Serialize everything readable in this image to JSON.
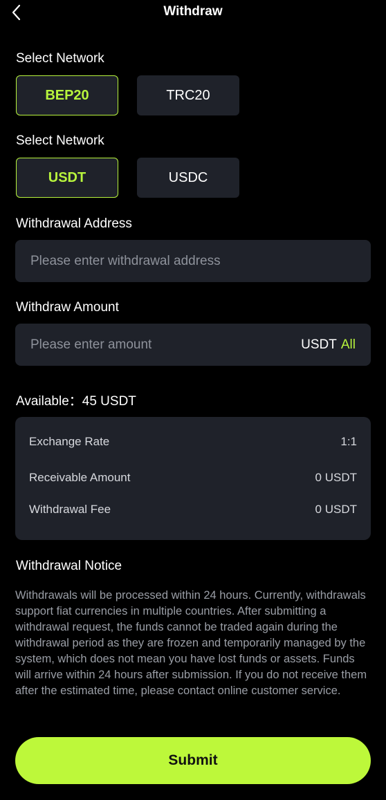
{
  "header": {
    "title": "Withdraw",
    "back_icon": "chevron-left-icon"
  },
  "network": {
    "label": "Select Network",
    "options": [
      "BEP20",
      "TRC20"
    ],
    "selected": "BEP20"
  },
  "currency": {
    "label": "Select Network",
    "options": [
      "USDT",
      "USDC"
    ],
    "selected": "USDT"
  },
  "address": {
    "label": "Withdrawal Address",
    "placeholder": "Please enter withdrawal address",
    "value": ""
  },
  "amount": {
    "label": "Withdraw Amount",
    "placeholder": "Please enter amount",
    "value": "",
    "currency": "USDT",
    "all_label": "All"
  },
  "available": {
    "text": "Available：",
    "value": "45 USDT"
  },
  "info": {
    "rows": [
      {
        "label": "Exchange Rate",
        "value": "1:1"
      },
      {
        "label": "Receivable Amount",
        "value": "0 USDT"
      },
      {
        "label": "Withdrawal Fee",
        "value": "0 USDT"
      }
    ]
  },
  "notice": {
    "title": "Withdrawal Notice",
    "text": "Withdrawals will be processed within 24 hours. Currently, withdrawals support fiat currencies in multiple countries. After submitting a withdrawal request, the funds cannot be traded again during the withdrawal period as they are frozen and temporarily managed by the system, which does not mean you have lost funds or assets. Funds will arrive within 24 hours after submission. If you do not receive them after the estimated time, please contact online customer service."
  },
  "submit_label": "Submit",
  "colors": {
    "accent": "#b8f53d",
    "background": "#000000",
    "card": "#1f222a",
    "muted_text": "#9a9ea6"
  }
}
